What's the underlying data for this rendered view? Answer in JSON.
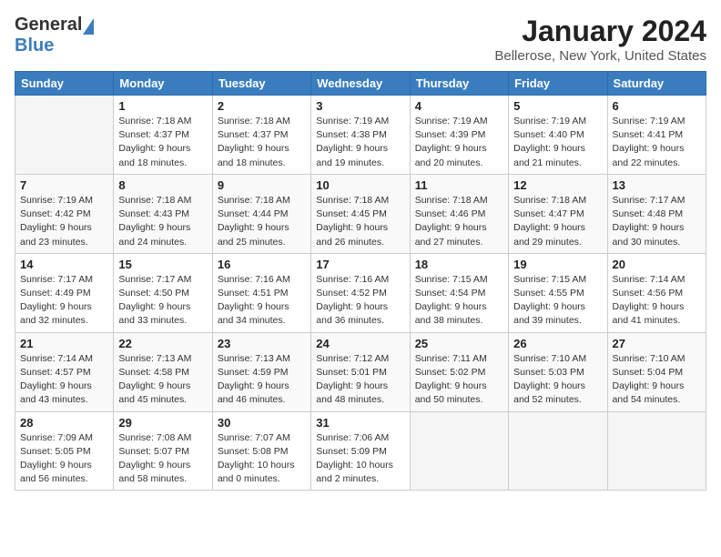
{
  "header": {
    "logo_general": "General",
    "logo_blue": "Blue",
    "title": "January 2024",
    "location": "Bellerose, New York, United States"
  },
  "days_of_week": [
    "Sunday",
    "Monday",
    "Tuesday",
    "Wednesday",
    "Thursday",
    "Friday",
    "Saturday"
  ],
  "weeks": [
    [
      {
        "day": "",
        "info": ""
      },
      {
        "day": "1",
        "info": "Sunrise: 7:18 AM\nSunset: 4:37 PM\nDaylight: 9 hours\nand 18 minutes."
      },
      {
        "day": "2",
        "info": "Sunrise: 7:18 AM\nSunset: 4:37 PM\nDaylight: 9 hours\nand 18 minutes."
      },
      {
        "day": "3",
        "info": "Sunrise: 7:19 AM\nSunset: 4:38 PM\nDaylight: 9 hours\nand 19 minutes."
      },
      {
        "day": "4",
        "info": "Sunrise: 7:19 AM\nSunset: 4:39 PM\nDaylight: 9 hours\nand 20 minutes."
      },
      {
        "day": "5",
        "info": "Sunrise: 7:19 AM\nSunset: 4:40 PM\nDaylight: 9 hours\nand 21 minutes."
      },
      {
        "day": "6",
        "info": "Sunrise: 7:19 AM\nSunset: 4:41 PM\nDaylight: 9 hours\nand 22 minutes."
      }
    ],
    [
      {
        "day": "7",
        "info": "Sunrise: 7:19 AM\nSunset: 4:42 PM\nDaylight: 9 hours\nand 23 minutes."
      },
      {
        "day": "8",
        "info": "Sunrise: 7:18 AM\nSunset: 4:43 PM\nDaylight: 9 hours\nand 24 minutes."
      },
      {
        "day": "9",
        "info": "Sunrise: 7:18 AM\nSunset: 4:44 PM\nDaylight: 9 hours\nand 25 minutes."
      },
      {
        "day": "10",
        "info": "Sunrise: 7:18 AM\nSunset: 4:45 PM\nDaylight: 9 hours\nand 26 minutes."
      },
      {
        "day": "11",
        "info": "Sunrise: 7:18 AM\nSunset: 4:46 PM\nDaylight: 9 hours\nand 27 minutes."
      },
      {
        "day": "12",
        "info": "Sunrise: 7:18 AM\nSunset: 4:47 PM\nDaylight: 9 hours\nand 29 minutes."
      },
      {
        "day": "13",
        "info": "Sunrise: 7:17 AM\nSunset: 4:48 PM\nDaylight: 9 hours\nand 30 minutes."
      }
    ],
    [
      {
        "day": "14",
        "info": "Sunrise: 7:17 AM\nSunset: 4:49 PM\nDaylight: 9 hours\nand 32 minutes."
      },
      {
        "day": "15",
        "info": "Sunrise: 7:17 AM\nSunset: 4:50 PM\nDaylight: 9 hours\nand 33 minutes."
      },
      {
        "day": "16",
        "info": "Sunrise: 7:16 AM\nSunset: 4:51 PM\nDaylight: 9 hours\nand 34 minutes."
      },
      {
        "day": "17",
        "info": "Sunrise: 7:16 AM\nSunset: 4:52 PM\nDaylight: 9 hours\nand 36 minutes."
      },
      {
        "day": "18",
        "info": "Sunrise: 7:15 AM\nSunset: 4:54 PM\nDaylight: 9 hours\nand 38 minutes."
      },
      {
        "day": "19",
        "info": "Sunrise: 7:15 AM\nSunset: 4:55 PM\nDaylight: 9 hours\nand 39 minutes."
      },
      {
        "day": "20",
        "info": "Sunrise: 7:14 AM\nSunset: 4:56 PM\nDaylight: 9 hours\nand 41 minutes."
      }
    ],
    [
      {
        "day": "21",
        "info": "Sunrise: 7:14 AM\nSunset: 4:57 PM\nDaylight: 9 hours\nand 43 minutes."
      },
      {
        "day": "22",
        "info": "Sunrise: 7:13 AM\nSunset: 4:58 PM\nDaylight: 9 hours\nand 45 minutes."
      },
      {
        "day": "23",
        "info": "Sunrise: 7:13 AM\nSunset: 4:59 PM\nDaylight: 9 hours\nand 46 minutes."
      },
      {
        "day": "24",
        "info": "Sunrise: 7:12 AM\nSunset: 5:01 PM\nDaylight: 9 hours\nand 48 minutes."
      },
      {
        "day": "25",
        "info": "Sunrise: 7:11 AM\nSunset: 5:02 PM\nDaylight: 9 hours\nand 50 minutes."
      },
      {
        "day": "26",
        "info": "Sunrise: 7:10 AM\nSunset: 5:03 PM\nDaylight: 9 hours\nand 52 minutes."
      },
      {
        "day": "27",
        "info": "Sunrise: 7:10 AM\nSunset: 5:04 PM\nDaylight: 9 hours\nand 54 minutes."
      }
    ],
    [
      {
        "day": "28",
        "info": "Sunrise: 7:09 AM\nSunset: 5:05 PM\nDaylight: 9 hours\nand 56 minutes."
      },
      {
        "day": "29",
        "info": "Sunrise: 7:08 AM\nSunset: 5:07 PM\nDaylight: 9 hours\nand 58 minutes."
      },
      {
        "day": "30",
        "info": "Sunrise: 7:07 AM\nSunset: 5:08 PM\nDaylight: 10 hours\nand 0 minutes."
      },
      {
        "day": "31",
        "info": "Sunrise: 7:06 AM\nSunset: 5:09 PM\nDaylight: 10 hours\nand 2 minutes."
      },
      {
        "day": "",
        "info": ""
      },
      {
        "day": "",
        "info": ""
      },
      {
        "day": "",
        "info": ""
      }
    ]
  ]
}
